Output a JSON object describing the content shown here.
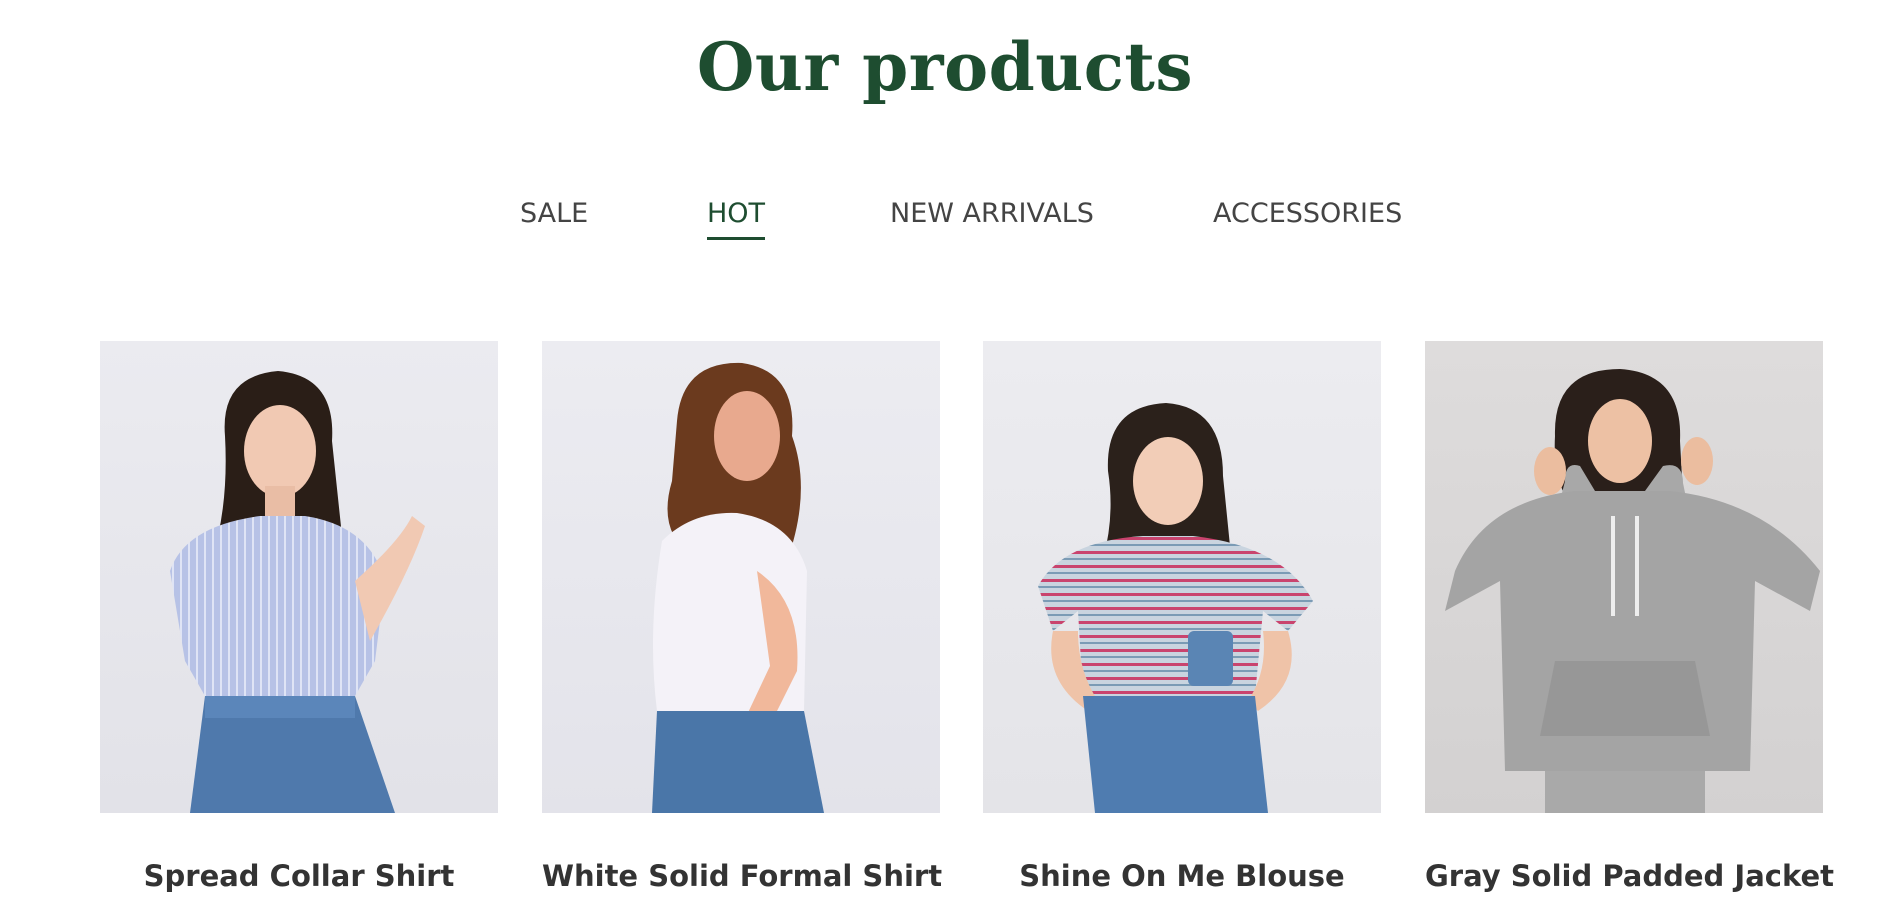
{
  "section": {
    "title": "Our products"
  },
  "tabs": [
    {
      "label": "SALE",
      "active": false
    },
    {
      "label": "HOT",
      "active": true
    },
    {
      "label": "NEW ARRIVALS",
      "active": false
    },
    {
      "label": "ACCESSORIES",
      "active": false
    }
  ],
  "products": [
    {
      "name": "Spread Collar Shirt",
      "image": "woman-blue-striped-shirt-photo"
    },
    {
      "name": "White Solid Formal Shirt",
      "image": "woman-white-tshirt-photo"
    },
    {
      "name": "Shine On Me Blouse",
      "image": "woman-striped-tee-photo"
    },
    {
      "name": "Gray Solid Padded Jacket",
      "image": "woman-gray-hoodie-photo"
    }
  ],
  "colors": {
    "accent": "#1e4d30",
    "tab_text": "#444444",
    "product_name": "#333333"
  }
}
